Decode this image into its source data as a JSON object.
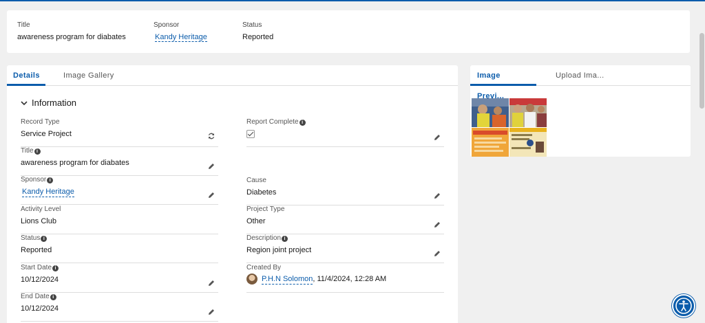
{
  "highlights": {
    "title_label": "Title",
    "title_value": "awareness program for diabates",
    "sponsor_label": "Sponsor",
    "sponsor_value": "Kandy Heritage",
    "status_label": "Status",
    "status_value": "Reported"
  },
  "main": {
    "tabs": [
      {
        "label": "Details",
        "active": true
      },
      {
        "label": "Image Gallery",
        "active": false
      }
    ],
    "section_title": "Information",
    "left_fields": [
      {
        "label": "Record Type",
        "value": "Service Project",
        "icon": "change-record-type-icon"
      },
      {
        "label": "Title",
        "value": "awareness program for diabates",
        "info": true,
        "icon": "edit-icon"
      },
      {
        "label": "Sponsor",
        "value": "Kandy Heritage",
        "info": true,
        "link": true,
        "icon": "edit-icon"
      },
      {
        "label": "Activity Level",
        "value": "Lions Club"
      },
      {
        "label": "Status",
        "value": "Reported",
        "info": true
      },
      {
        "label": "Start Date",
        "value": "10/12/2024",
        "info": true,
        "icon": "edit-icon"
      },
      {
        "label": "End Date",
        "value": "10/12/2024",
        "info": true,
        "icon": "edit-icon"
      }
    ],
    "right_fields": [
      {
        "label": "Report Complete",
        "checked": true,
        "info": true,
        "icon": "edit-icon"
      },
      {
        "label": "Cause",
        "value": "Diabetes",
        "icon": "edit-icon"
      },
      {
        "label": "Project Type",
        "value": "Other",
        "icon": "edit-icon"
      },
      {
        "label": "Description",
        "value": "Region joint project",
        "info": true,
        "icon": "edit-icon"
      },
      {
        "label": "Created By",
        "user": "P.H.N Solomon",
        "timestamp": ", 11/4/2024, 12:28 AM"
      }
    ]
  },
  "side": {
    "tabs": [
      {
        "label": "Image Previ...",
        "active": true
      },
      {
        "label": "Upload Ima...",
        "active": false
      }
    ]
  },
  "colors": {
    "accent": "#0b5cab",
    "background": "#f0f0f0"
  }
}
